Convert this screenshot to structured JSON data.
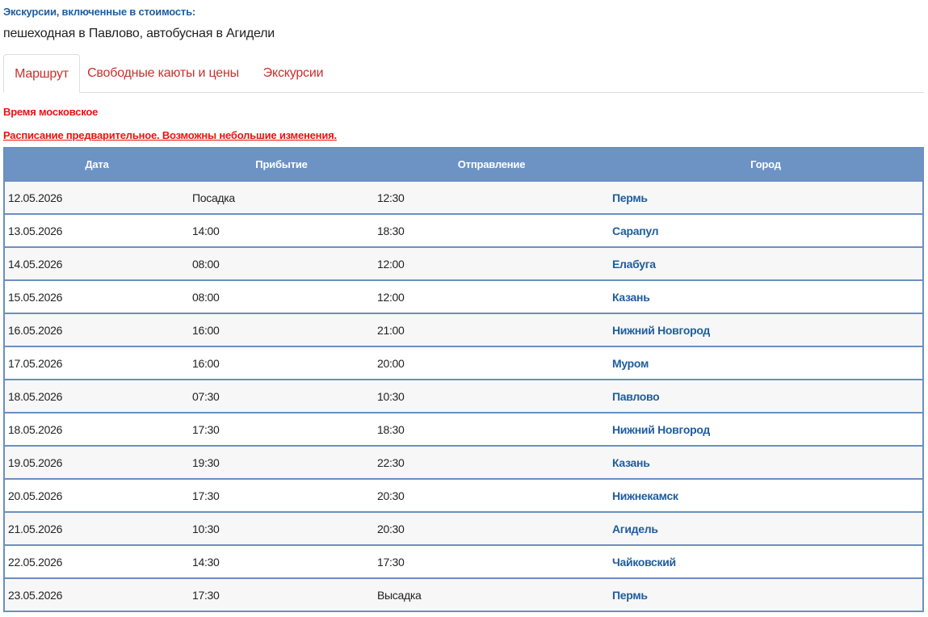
{
  "included": {
    "heading": "Экскурсии, включенные в стоимость:",
    "text": "пешеходная в Павлово, автобусная в Агидели"
  },
  "tabs": [
    {
      "label": "Маршрут",
      "active": true
    },
    {
      "label": "Свободные каюты и цены",
      "active": false
    },
    {
      "label": "Экскурсии",
      "active": false
    }
  ],
  "notices": {
    "time": "Время московское",
    "schedule": "Расписание предварительное. Возможны небольшие изменения."
  },
  "table": {
    "headers": [
      "Дата",
      "Прибытие",
      "Отправление",
      "Город"
    ],
    "rows": [
      [
        "12.05.2026",
        "Посадка",
        "12:30",
        "Пермь"
      ],
      [
        "13.05.2026",
        "14:00",
        "18:30",
        "Сарапул"
      ],
      [
        "14.05.2026",
        "08:00",
        "12:00",
        "Елабуга"
      ],
      [
        "15.05.2026",
        "08:00",
        "12:00",
        "Казань"
      ],
      [
        "16.05.2026",
        "16:00",
        "21:00",
        "Нижний Новгород"
      ],
      [
        "17.05.2026",
        "16:00",
        "20:00",
        "Муром"
      ],
      [
        "18.05.2026",
        "07:30",
        "10:30",
        "Павлово"
      ],
      [
        "18.05.2026",
        "17:30",
        "18:30",
        "Нижний Новгород"
      ],
      [
        "19.05.2026",
        "19:30",
        "22:30",
        "Казань"
      ],
      [
        "20.05.2026",
        "17:30",
        "20:30",
        "Нижнекамск"
      ],
      [
        "21.05.2026",
        "10:30",
        "20:30",
        "Агидель"
      ],
      [
        "22.05.2026",
        "14:30",
        "17:30",
        "Чайковский"
      ],
      [
        "23.05.2026",
        "17:30",
        "Высадка",
        "Пермь"
      ]
    ]
  },
  "colors": {
    "header_bg": "#6d93c4",
    "link": "#1f5d9e",
    "tab_text": "#c9302c",
    "notice": "#ee1111"
  }
}
